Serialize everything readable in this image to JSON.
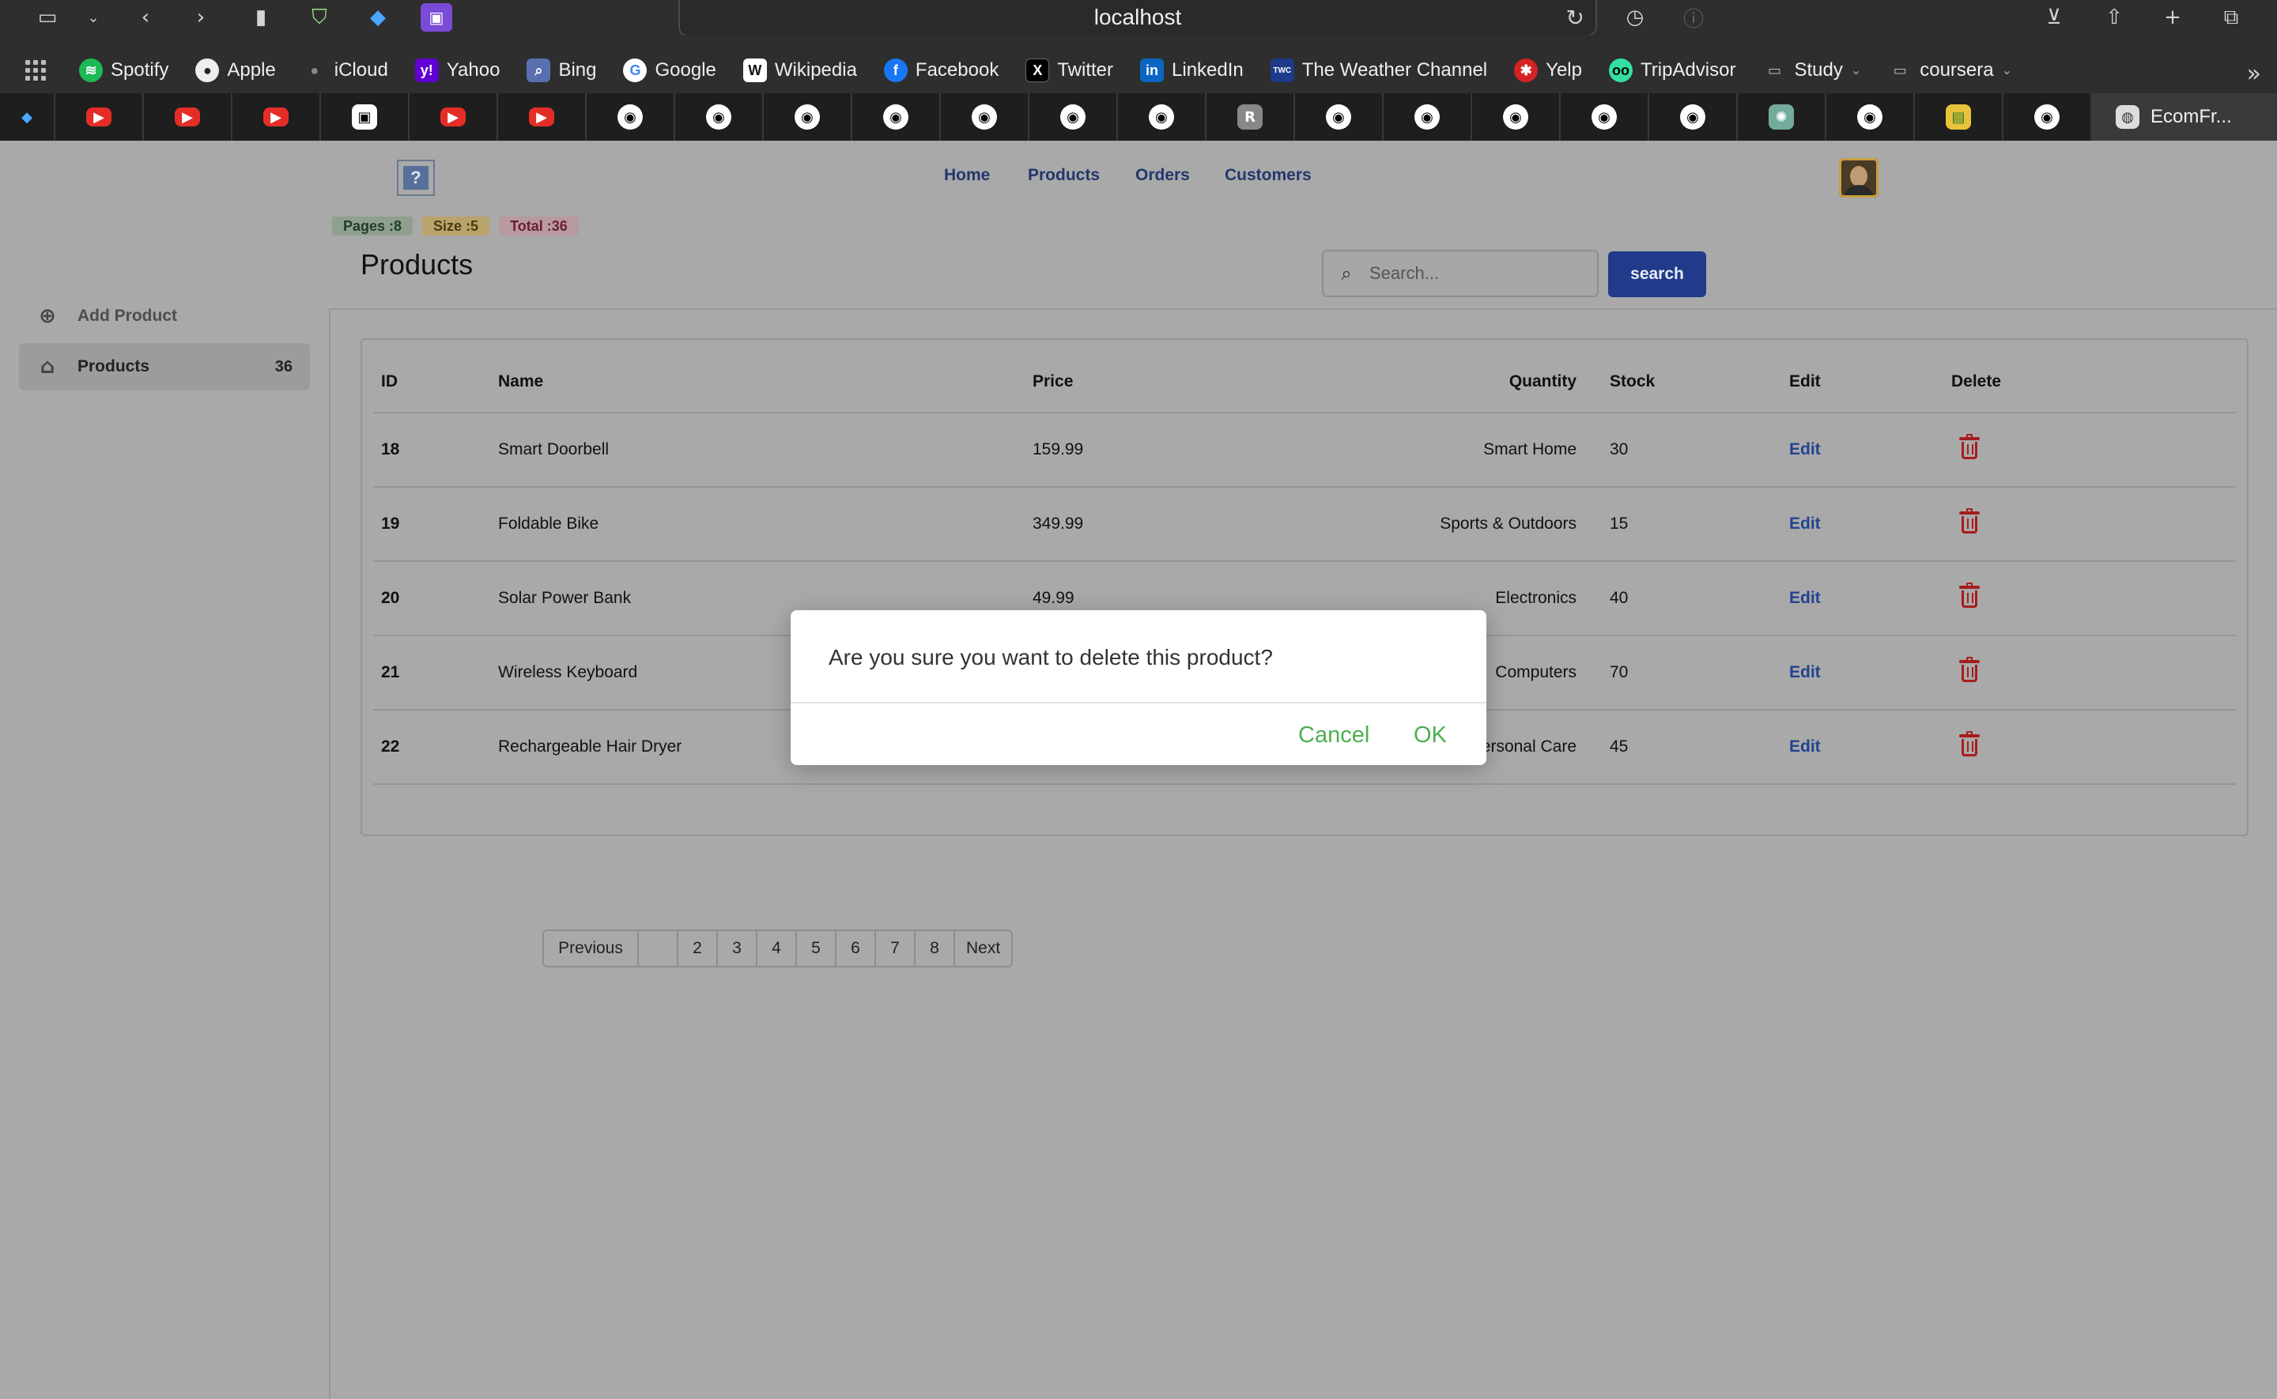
{
  "browser": {
    "url": "localhost",
    "bookmarks": [
      {
        "label": "Spotify",
        "icon": "spotify-icon",
        "color": "#1db954"
      },
      {
        "label": "Apple",
        "icon": "apple-icon",
        "color": "#444444"
      },
      {
        "label": "iCloud",
        "icon": "icloud-icon",
        "color": "#444444"
      },
      {
        "label": "Yahoo",
        "icon": "yahoo-icon",
        "color": "#6001d2"
      },
      {
        "label": "Bing",
        "icon": "bing-icon",
        "color": "#5a6fb0"
      },
      {
        "label": "Google",
        "icon": "google-icon",
        "color": "#ffffff"
      },
      {
        "label": "Wikipedia",
        "icon": "wikipedia-icon",
        "color": "#ffffff"
      },
      {
        "label": "Facebook",
        "icon": "facebook-icon",
        "color": "#1877f2"
      },
      {
        "label": "Twitter",
        "icon": "x-icon",
        "color": "#000000"
      },
      {
        "label": "LinkedIn",
        "icon": "linkedin-icon",
        "color": "#0a66c2"
      },
      {
        "label": "The Weather Channel",
        "icon": "weather-channel-icon",
        "color": "#1c3b8a"
      },
      {
        "label": "Yelp",
        "icon": "yelp-icon",
        "color": "#d32323"
      },
      {
        "label": "TripAdvisor",
        "icon": "tripadvisor-icon",
        "color": "#34e0a1"
      },
      {
        "label": "Study",
        "icon": "folder-icon",
        "color": "#2e2e2e"
      },
      {
        "label": "coursera",
        "icon": "folder-icon",
        "color": "#2e2e2e"
      }
    ],
    "active_tab_label": "EcomFr..."
  },
  "app": {
    "nav": {
      "home": "Home",
      "products": "Products",
      "orders": "Orders",
      "customers": "Customers"
    },
    "badges": {
      "pages": "Pages :8",
      "size": "Size :5",
      "total": "Total :36"
    },
    "page_title": "Products",
    "search": {
      "placeholder": "Search...",
      "button": "search"
    },
    "sidebar": {
      "add_product": "Add Product",
      "products": "Products",
      "products_count": "36"
    },
    "table": {
      "headers": {
        "id": "ID",
        "name": "Name",
        "price": "Price",
        "quantity": "Quantity",
        "stock": "Stock",
        "edit": "Edit",
        "delete": "Delete"
      },
      "rows": [
        {
          "id": "18",
          "name": "Smart Doorbell",
          "price": "159.99",
          "quantity": "Smart Home",
          "stock": "30",
          "edit": "Edit"
        },
        {
          "id": "19",
          "name": "Foldable Bike",
          "price": "349.99",
          "quantity": "Sports & Outdoors",
          "stock": "15",
          "edit": "Edit"
        },
        {
          "id": "20",
          "name": "Solar Power Bank",
          "price": "49.99",
          "quantity": "Electronics",
          "stock": "40",
          "edit": "Edit"
        },
        {
          "id": "21",
          "name": "Wireless Keyboard",
          "price": "",
          "quantity": "Computers",
          "stock": "70",
          "edit": "Edit"
        },
        {
          "id": "22",
          "name": "Rechargeable Hair Dryer",
          "price": "",
          "quantity": "Personal Care",
          "stock": "45",
          "edit": "Edit"
        }
      ]
    },
    "pagination": {
      "previous": "Previous",
      "pages": [
        "2",
        "3",
        "4",
        "5",
        "6",
        "7",
        "8"
      ],
      "next": "Next"
    }
  },
  "dialog": {
    "message": "Are you sure you want to delete this product?",
    "cancel": "Cancel",
    "ok": "OK"
  }
}
